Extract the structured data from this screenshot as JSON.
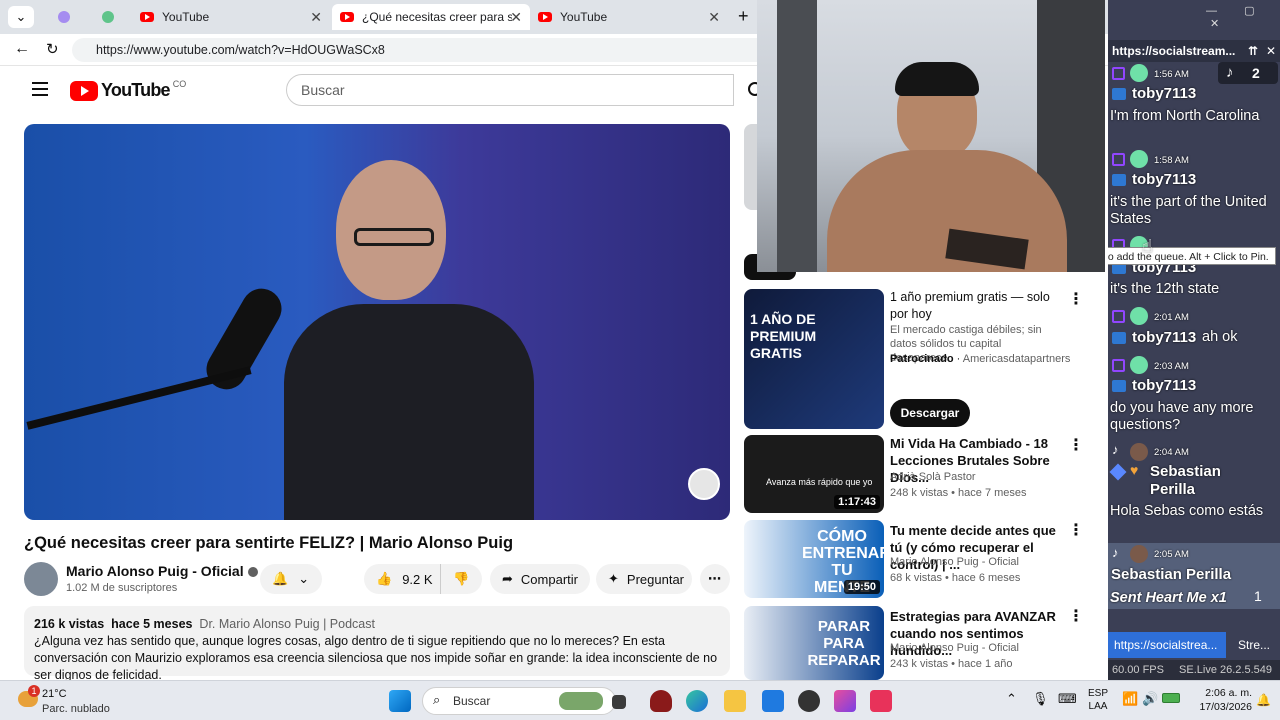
{
  "browser": {
    "tabs": [
      {
        "label": "YouTube"
      },
      {
        "label": "¿Qué necesitas creer para sentirte"
      },
      {
        "label": "YouTube"
      }
    ],
    "url": "https://www.youtube.com/watch?v=HdOUGWaSCx8"
  },
  "youtube": {
    "logo_text": "YouTube",
    "country": "CO",
    "search_placeholder": "Buscar",
    "video_title": "¿Qué necesitas creer para sentirte FELIZ? | Mario Alonso Puig",
    "channel_name": "Mario Alonso Puig - Oficial",
    "subscribers": "1.02 M de suscriptores",
    "likes": "9.2 K",
    "share_label": "Compartir",
    "ask_label": "Preguntar",
    "description": {
      "views": "216 k vistas",
      "age": "hace 5 meses",
      "tag": "Dr. Mario Alonso Puig | Podcast",
      "text": "¿Alguna vez has sentido que, aunque logres cosas, algo dentro de ti sigue repitiendo que no lo mereces? En esta conversación con Maurizio exploramos esa creencia silenciosa que nos impide soñar en grande: la idea inconsciente de no ser dignos de felicidad."
    },
    "sidebar": [
      {
        "title": "1 año premium gratis — solo por hoy",
        "line2": "El mercado castiga débiles; sin datos sólidos tu capital desaparece.",
        "sponsor_label": "Patrocinado",
        "sponsor": "Americasdatapartners",
        "cta": "Descargar",
        "thumb_text": "1 AÑO DE PREMIUM GRATIS"
      },
      {
        "title": "Mi Vida Ha Cambiado - 18 Lecciones Brutales Sobre Dios...",
        "channel": "Adrià Solà Pastor",
        "meta": "248 k vistas • hace 7 meses",
        "duration": "1:17:43",
        "thumb_text": "Avanza más rápido que yo"
      },
      {
        "title": "Tu mente decide antes que tú (y cómo recuperar el control) | ...",
        "channel": "Mario Alonso Puig - Oficial",
        "meta": "68 k vistas • hace 6 meses",
        "duration": "19:50",
        "thumb_text": "CÓMO ENTRENAR TU MENTE"
      },
      {
        "title": "Estrategias para AVANZAR cuando nos sentimos hundido...",
        "channel": "Mario Alonso Puig - Oficial",
        "meta": "243 k vistas • hace 1 año",
        "duration": "",
        "thumb_text": "PARAR PARA REPARAR"
      }
    ]
  },
  "chat": {
    "url": "https://socialstream...",
    "tiktok_count": "2",
    "tooltip": "to add the queue. Alt + Click to Pin.",
    "messages": [
      {
        "time": "1:56 AM",
        "user": "toby7113",
        "text": "I'm from North Carolina"
      },
      {
        "time": "1:58 AM",
        "user": "toby7113",
        "text": "it's the part of the United States"
      },
      {
        "time": "",
        "user": "toby7113",
        "text": "it's the 12th state"
      },
      {
        "time": "2:01 AM",
        "user": "toby7113",
        "text": "ah ok"
      },
      {
        "time": "2:03 AM",
        "user": "toby7113",
        "text": "do you have any more questions?"
      },
      {
        "time": "2:04 AM",
        "user": "Sebastian Perilla",
        "text": "Hola Sebas como estás"
      },
      {
        "time": "2:05 AM",
        "user": "Sebastian Perilla",
        "text": "Sent Heart Me x1",
        "count": "1"
      }
    ],
    "bottom_tabs": [
      "https://socialstrea...",
      "Stre..."
    ],
    "fps": "60.00 FPS",
    "version": "SE.Live 26.2.5.549"
  },
  "taskbar": {
    "weather_temp": "21°C",
    "weather_desc": "Parc. nublado",
    "notif_count": "1",
    "search_placeholder": "Buscar",
    "lang1": "ESP",
    "lang2": "LAA",
    "time": "2:06 a. m.",
    "date": "17/03/2026"
  }
}
